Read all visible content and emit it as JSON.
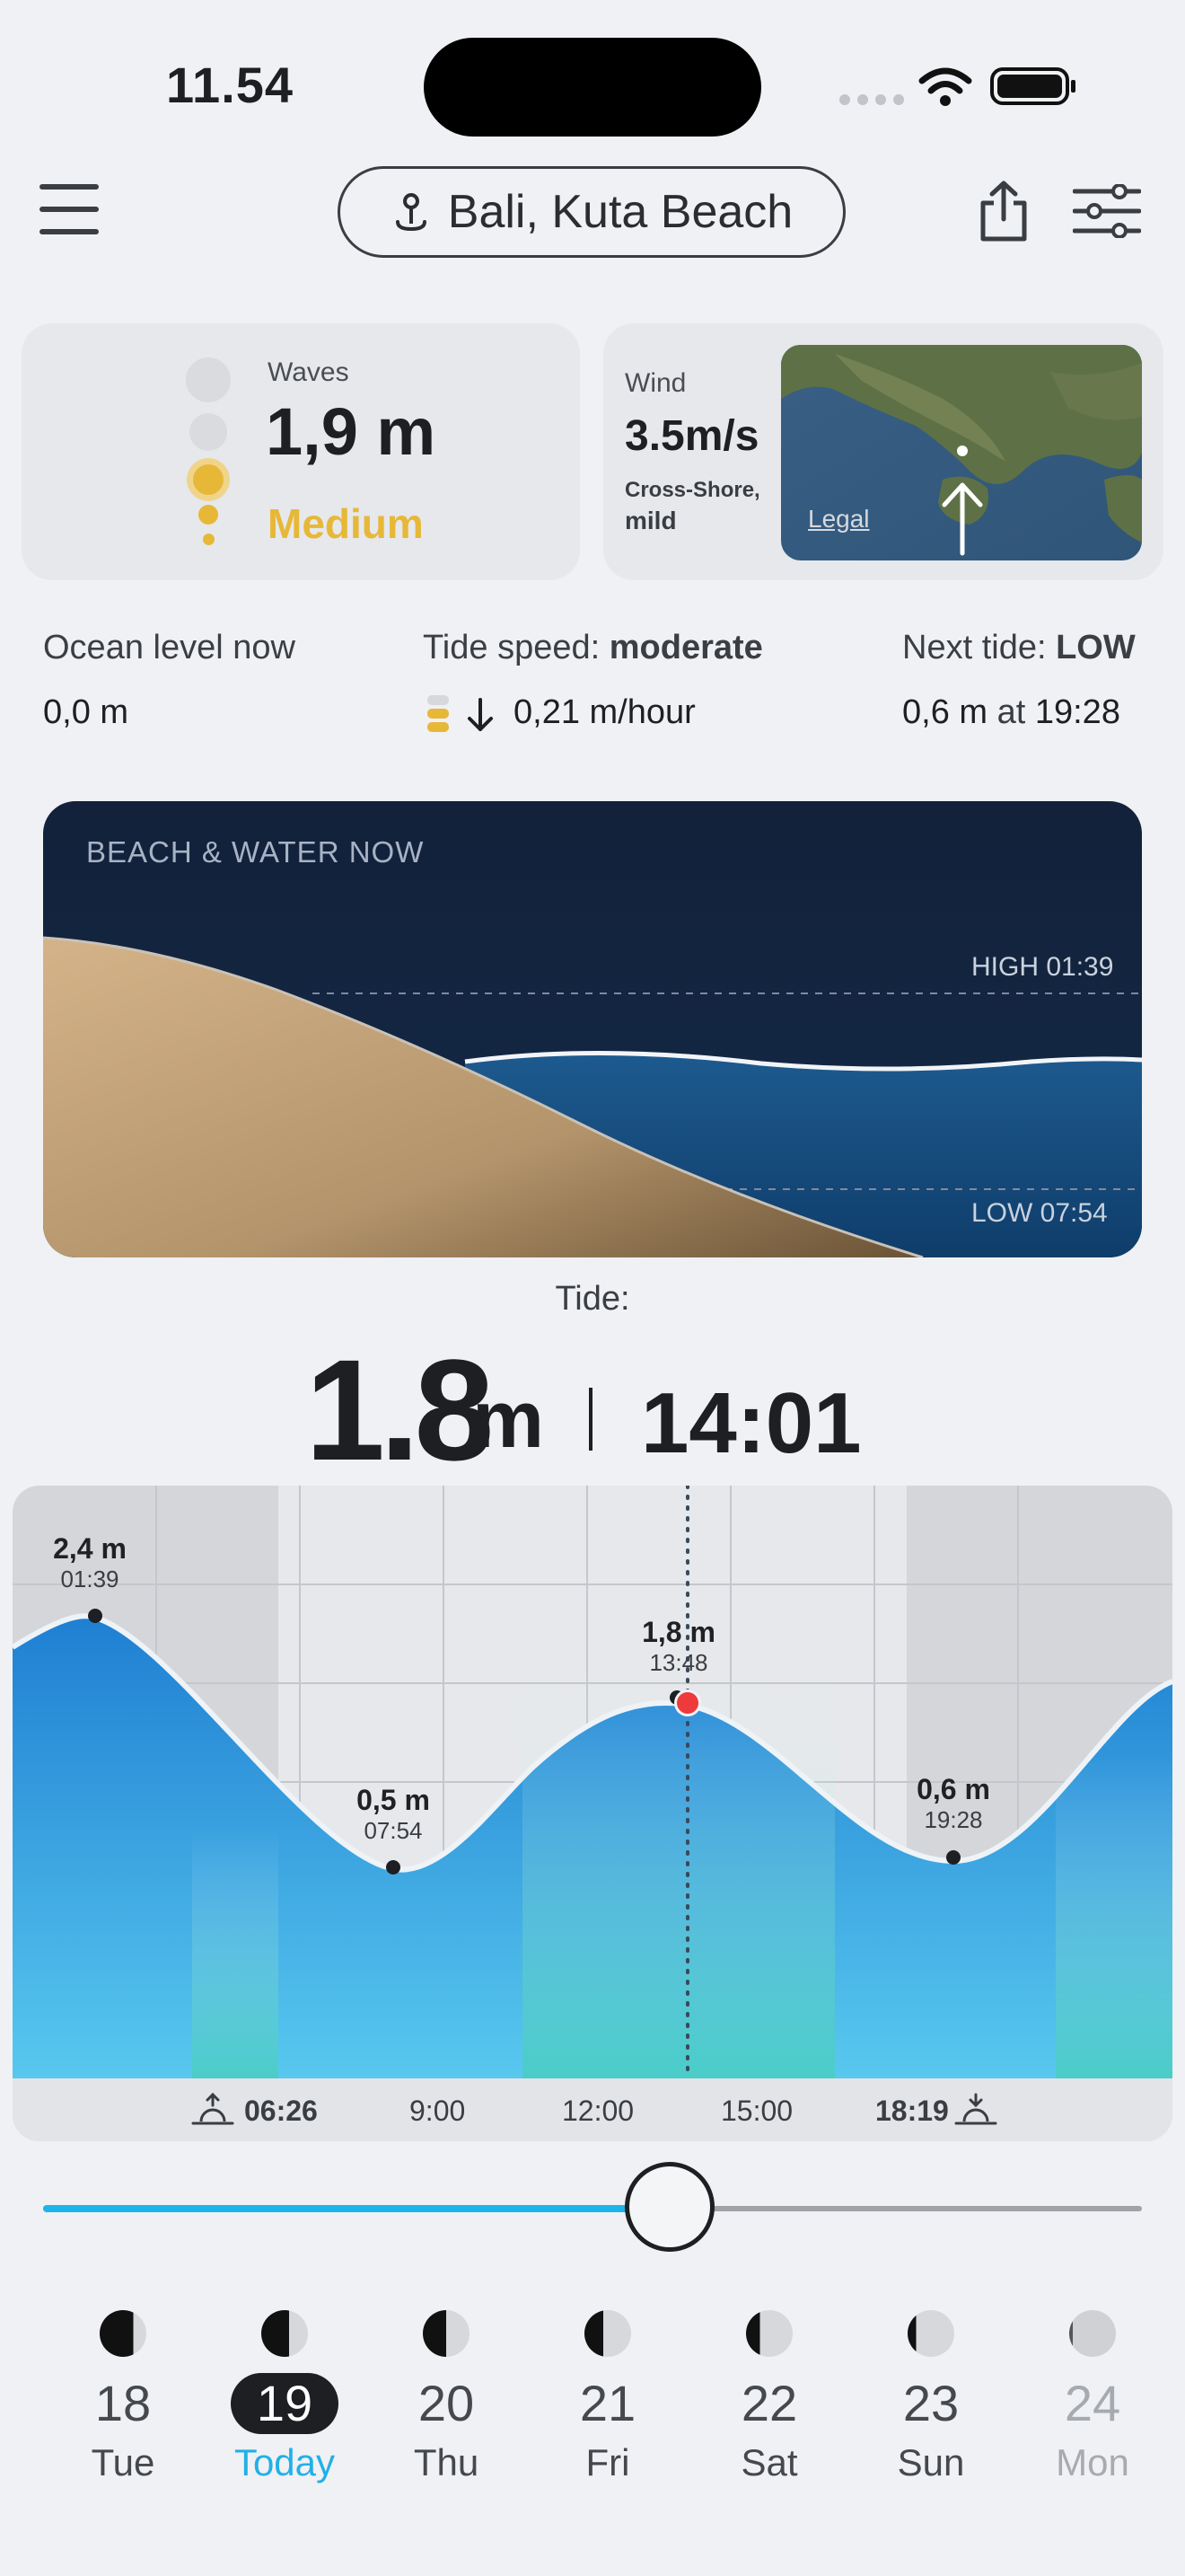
{
  "status_bar": {
    "time": "11.54"
  },
  "header": {
    "location": "Bali, Kuta Beach"
  },
  "waves": {
    "label": "Waves",
    "value": "1,9 m",
    "severity": "Medium",
    "severity_color": "#e7b838",
    "level": 3,
    "level_max": 5
  },
  "wind": {
    "label": "Wind",
    "speed": "3.5m/s",
    "direction": "Cross-Shore,",
    "strength": "mild",
    "map_legal": "Legal"
  },
  "ocean": {
    "label": "Ocean level now",
    "value": "0,0 m"
  },
  "tide_speed": {
    "label": "Tide speed: ",
    "label_strong": "moderate",
    "value": "0,21 m/hour",
    "direction": "falling"
  },
  "next_tide": {
    "label": "Next tide: ",
    "label_strong": "LOW",
    "value": "0,6 m",
    "at": " at ",
    "time": "19:28"
  },
  "beach": {
    "title": "BEACH & WATER NOW",
    "high_label": "HIGH 01:39",
    "low_label": "LOW 07:54"
  },
  "tide_now": {
    "caption": "Tide:",
    "height": "1.8",
    "unit": "m",
    "time": "14:01"
  },
  "chart": {
    "extremes": [
      {
        "height": "2,4 m",
        "time": "01:39"
      },
      {
        "height": "0,5 m",
        "time": "07:54"
      },
      {
        "height": "1,8 m",
        "time": "13:48"
      },
      {
        "height": "0,6 m",
        "time": "19:28"
      }
    ],
    "axis": {
      "sunrise": "06:26",
      "t1": "9:00",
      "t2": "12:00",
      "t3": "15:00",
      "sunset": "18:19"
    }
  },
  "slider": {
    "progress": 0.57
  },
  "days": [
    {
      "num": "18",
      "name": "Tue"
    },
    {
      "num": "19",
      "name": "Today"
    },
    {
      "num": "20",
      "name": "Thu"
    },
    {
      "num": "21",
      "name": "Fri"
    },
    {
      "num": "22",
      "name": "Sat"
    },
    {
      "num": "23",
      "name": "Sun"
    },
    {
      "num": "24",
      "name": "Mon"
    }
  ]
}
